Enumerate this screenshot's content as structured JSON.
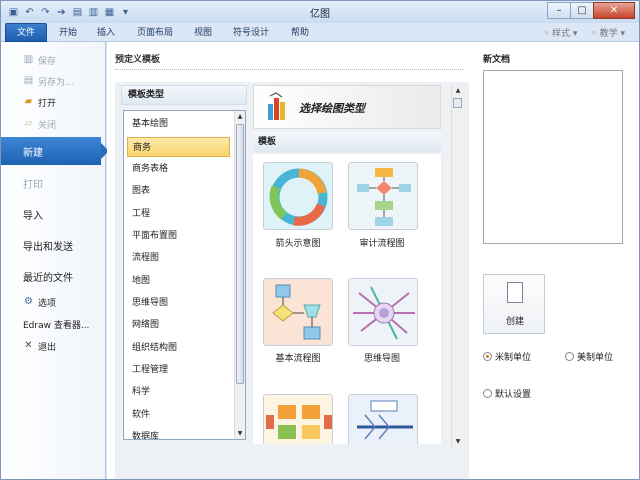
{
  "app": {
    "title": "亿图"
  },
  "window_controls": {
    "minimize": "–",
    "maximize": "□",
    "close": "✕"
  },
  "quick_access": [
    "save-icon",
    "undo-icon",
    "redo-icon",
    "dropdown-icon"
  ],
  "ribbon": {
    "tabs": [
      "文件",
      "开始",
      "插入",
      "页面布局",
      "视图",
      "符号设计",
      "帮助"
    ],
    "right": [
      "样式",
      "教学"
    ]
  },
  "backstage_menu": {
    "small_items": [
      {
        "label": "保存",
        "icon": "save-icon",
        "disabled": true
      },
      {
        "label": "另存为...",
        "icon": "save-as-icon",
        "disabled": true
      },
      {
        "label": "打开",
        "icon": "open-folder-icon",
        "disabled": false
      },
      {
        "label": "关闭",
        "icon": "close-folder-icon",
        "disabled": true
      }
    ],
    "big_items": [
      {
        "label": "新建",
        "active": true
      },
      {
        "label": "打印",
        "disabled": true
      },
      {
        "label": "导入"
      },
      {
        "label": "导出和发送"
      },
      {
        "label": "最近的文件"
      }
    ],
    "bottom_items": [
      {
        "label": "选项",
        "icon": "options-icon"
      },
      {
        "label": "Edraw 查看器...",
        "icon": ""
      },
      {
        "label": "退出",
        "icon": "exit-icon"
      }
    ]
  },
  "templates_panel": {
    "title": "预定义模板",
    "category_header": "模板类型",
    "categories": [
      "基本绘图",
      "商务",
      "商务表格",
      "图表",
      "工程",
      "平面布置图",
      "流程图",
      "地图",
      "思维导图",
      "网络图",
      "组织结构图",
      "工程管理",
      "科学",
      "软件",
      "数据库"
    ],
    "selected_category": "商务",
    "banner_text": "选择绘图类型",
    "templates_header": "模板",
    "templates": [
      {
        "label": "箭头示意图"
      },
      {
        "label": "审计流程图"
      },
      {
        "label": "基本流程图"
      },
      {
        "label": "思维导图"
      },
      {
        "label": ""
      },
      {
        "label": ""
      }
    ]
  },
  "new_document": {
    "title": "新文档",
    "create_label": "创建",
    "units": [
      {
        "label": "米制单位",
        "checked": true
      },
      {
        "label": "美制单位",
        "checked": false
      }
    ],
    "default_label": "默认设置"
  },
  "colors": {
    "accent": "#2a6fbf",
    "selected_bg": "#f8d36b"
  }
}
